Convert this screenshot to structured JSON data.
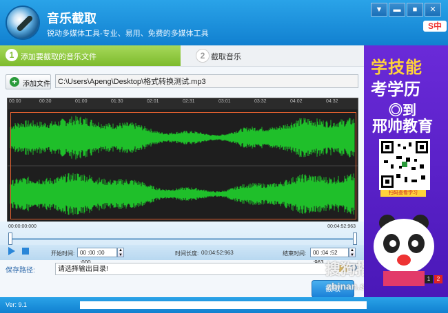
{
  "app": {
    "title": "音乐截取",
    "subtitle": "锐动多媒体工具-专业、易用、免费的多媒体工具",
    "win_buttons": [
      "▼",
      "▬",
      "■",
      "✕"
    ],
    "sogou_logo": "S中"
  },
  "steps": [
    {
      "num": "1",
      "label": "添加要截取的音乐文件"
    },
    {
      "num": "2",
      "label": "截取音乐"
    }
  ],
  "file": {
    "add_label": "添加文件",
    "path": "C:\\Users\\Apeng\\Desktop\\格式转换测试.mp3"
  },
  "timeline": {
    "ticks": [
      "00:00",
      "00:30",
      "01:00",
      "01:30",
      "02:01",
      "02:31",
      "03:01",
      "03:32",
      "04:02",
      "04:32"
    ],
    "start_time": "00:00:00:000",
    "end_time": "00:04:52:963"
  },
  "controls": {
    "start_label": "开始时间:",
    "start_value": "00 :00 :00 :000",
    "length_label": "时间长度:",
    "length_value": "00:04:52:963",
    "end_label": "结束时间:",
    "end_value": "00 :04 :52 :963"
  },
  "output": {
    "label": "保存路径:",
    "placeholder": "请选择输出目录!",
    "action_label": "截取"
  },
  "ad": {
    "line1a": "学",
    "line1b": "技能",
    "line2": "考学历",
    "line3": "◎到",
    "line4": "邢帅教育",
    "qr_caption": "扫码查看学习",
    "page_btns": [
      "1",
      "2"
    ]
  },
  "watermark": {
    "main": "搜狗指南",
    "sub": "zhinan.sogou.com"
  },
  "status": {
    "version": "Ver: 9.1"
  },
  "colors": {
    "title_blue": "#1a8ee0",
    "step_green": "#7dbb2d",
    "wave_green": "#1fbf2a",
    "ad_purple": "#5a20c8"
  }
}
